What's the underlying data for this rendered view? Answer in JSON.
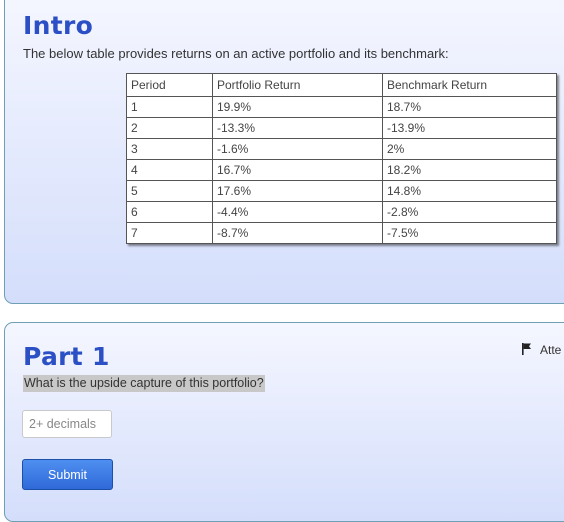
{
  "intro": {
    "title": "Intro",
    "description": "The below table provides returns on an active portfolio and its benchmark:",
    "table": {
      "headers": [
        "Period",
        "Portfolio Return",
        "Benchmark Return"
      ],
      "rows": [
        [
          "1",
          "19.9%",
          "18.7%"
        ],
        [
          "2",
          "-13.3%",
          "-13.9%"
        ],
        [
          "3",
          "-1.6%",
          "2%"
        ],
        [
          "4",
          "16.7%",
          "18.2%"
        ],
        [
          "5",
          "17.6%",
          "14.8%"
        ],
        [
          "6",
          "-4.4%",
          "-2.8%"
        ],
        [
          "7",
          "-8.7%",
          "-7.5%"
        ]
      ]
    }
  },
  "part1": {
    "title": "Part 1",
    "question": "What is the upside capture of this portfolio?",
    "flag_icon": "flag-icon",
    "attempt_label": "Atte",
    "answer": {
      "value": "",
      "placeholder": "2+ decimals"
    },
    "submit_label": "Submit"
  },
  "colors": {
    "heading": "#2b4fc4",
    "card_border": "#6f9fb5",
    "button": "#3a76e2",
    "question_highlight": "#c8c8c8"
  }
}
